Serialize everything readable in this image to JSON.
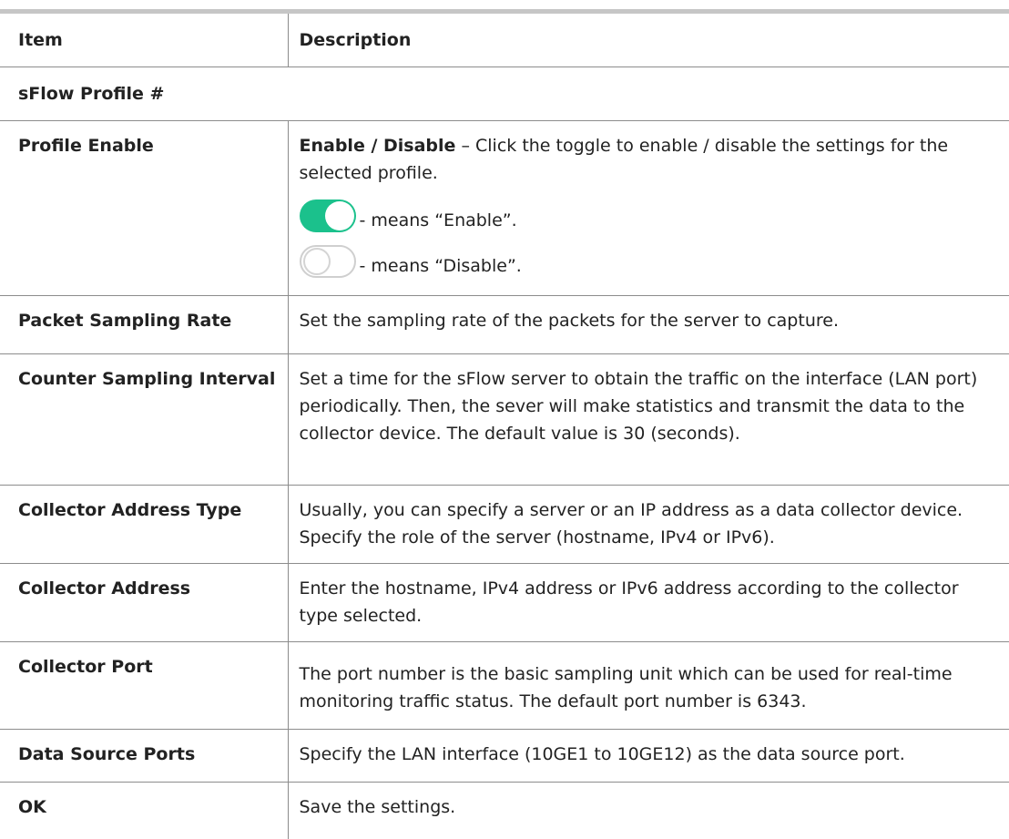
{
  "header": {
    "col1": "Item",
    "col2": "Description"
  },
  "section_title": "sFlow Profile #",
  "rows": [
    {
      "item": "Profile Enable",
      "desc_bold": "Enable / Disable",
      "desc": " – Click the toggle to enable / disable the settings for the selected profile.",
      "enable_text": "- means “Enable”.",
      "disable_text": "- means “Disable”."
    },
    {
      "item": "Packet Sampling Rate",
      "desc": "Set the sampling rate of the packets for the server to capture."
    },
    {
      "item": "Counter Sampling Interval",
      "desc": "Set a time for the sFlow server to obtain the traffic on the interface (LAN port) periodically. Then, the sever will make statistics and transmit the data to the collector device. The default value is 30 (seconds)."
    },
    {
      "item": "Collector Address Type",
      "desc": "Usually, you can specify a server or an IP address as a data collector device. Specify the role of the server (hostname, IPv4 or IPv6)."
    },
    {
      "item": "Collector Address",
      "desc": "Enter the hostname, IPv4 address or IPv6 address according to the collector type selected."
    },
    {
      "item": "Collector Port",
      "desc": "The port number is the basic sampling unit which can be used for real-time monitoring traffic status. The default port number is 6343."
    },
    {
      "item": "Data Source Ports",
      "desc": "Specify the LAN interface (10GE1 to 10GE12) as the data source port."
    },
    {
      "item": "OK",
      "desc": "Save the settings."
    }
  ],
  "colors": {
    "toggle_on": "#1bc18c",
    "toggle_off_border": "#cfcfcf",
    "rule": "#c6c6c6"
  },
  "icons": {
    "enable": "toggle-on-icon",
    "disable": "toggle-off-icon"
  }
}
